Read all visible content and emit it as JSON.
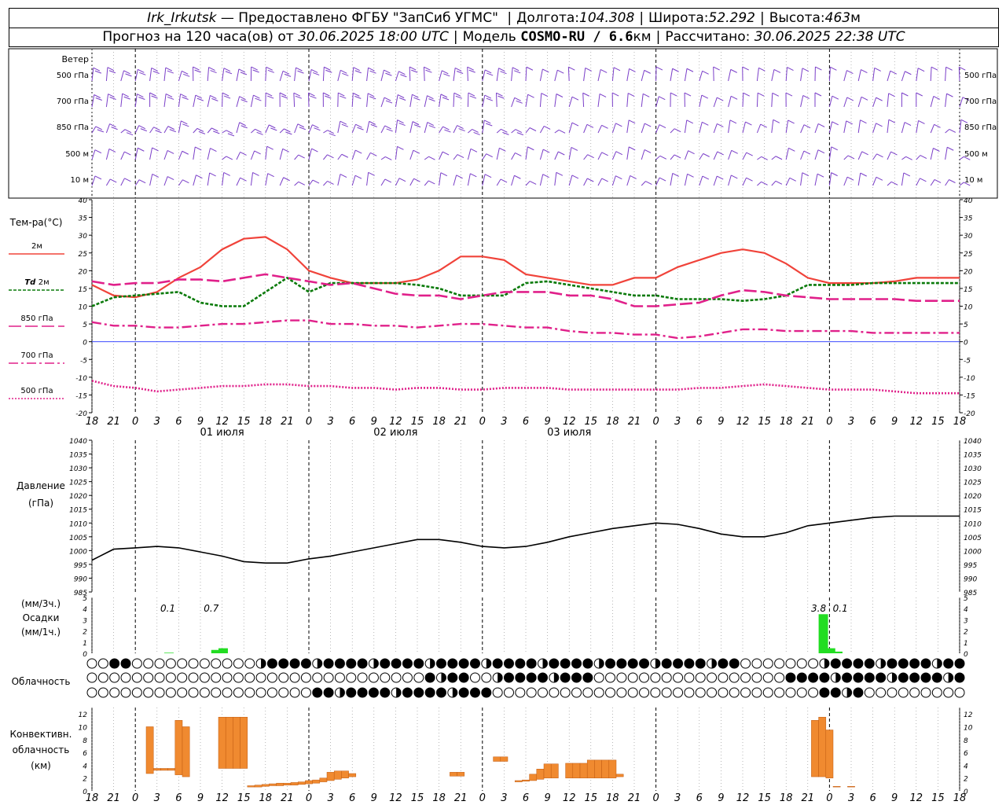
{
  "header": {
    "station": "Irk_Irkutsk",
    "provider": " — Предоставлено ФГБУ \"ЗапСиб УГМС\" ",
    "lon_label": "Долгота:",
    "lon_value": "104.308",
    "lat_label": "Широта:",
    "lat_value": "52.292",
    "alt_label": "Высота:",
    "alt_value": "463",
    "alt_unit": "м",
    "forecast_prefix": "Прогноз на 120 часа(ов) от ",
    "forecast_time": "30.06.2025 18:00 UTC",
    "model_label": "Модель ",
    "model_name": "COSMO-RU / 6.6",
    "model_unit": "км",
    "calc_label": "Рассчитано: ",
    "calc_time": "30.06.2025 22:38 UTC"
  },
  "colors": {
    "t2m": "#f0433a",
    "td2m": "#0a7a0a",
    "t850": "#e0208a",
    "t700": "#e0208a",
    "t500": "#e0208a",
    "wind": "#7a3ec8",
    "pressure": "#000000",
    "precip": "#22dd22",
    "conv": "#f08a30",
    "zero_line": "#2030ff"
  },
  "wind_panel": {
    "title": "Ветер",
    "levels": [
      "500 гПа",
      "700 гПа",
      "850 гПа",
      "500 м",
      "10  м"
    ]
  },
  "temp_panel": {
    "title": "Тем-ра(°C)",
    "legend": [
      {
        "label": "2м",
        "style": "solid"
      },
      {
        "label_italic": "Td",
        "label": "2м",
        "style": "dash-green"
      },
      {
        "label": "850 гПа",
        "style": "longdash"
      },
      {
        "label": "700 гПа",
        "style": "dashdot"
      },
      {
        "label": "500 гПа",
        "style": "dot"
      }
    ]
  },
  "time_axis": {
    "hour_labels": [
      "18",
      "21",
      "0",
      "3",
      "6",
      "9",
      "12",
      "15",
      "18",
      "21",
      "0",
      "3",
      "6",
      "9",
      "12",
      "15",
      "18",
      "21",
      "0",
      "3",
      "6",
      "9",
      "12",
      "15",
      "18",
      "21",
      "0"
    ],
    "day_labels": [
      "01 июля",
      "02 июля",
      "03 июля"
    ]
  },
  "pressure_panel": {
    "title_line1": "Давление",
    "title_line2": "(гПа)"
  },
  "precip_panel": {
    "title_line1": "(мм/3ч.)",
    "title_line2": "Осадки",
    "title_line3": "(мм/1ч.)",
    "annotations": [
      {
        "hour": 10.5,
        "text": "0.1"
      },
      {
        "hour": 16.5,
        "text": "0.7"
      },
      {
        "hour": 100.5,
        "text": "3.8"
      },
      {
        "hour": 103.5,
        "text": "0.1"
      }
    ]
  },
  "cloud_panel": {
    "title": "Облачность"
  },
  "conv_panel": {
    "title_line1": "Конвективн.",
    "title_line2": "облачность",
    "title_line3": "(км)"
  },
  "chart_data": [
    {
      "type": "line",
      "name": "temperature",
      "ylabel": "Тем-ра(°C)",
      "ylim": [
        -20,
        40
      ],
      "y_ticks": [
        -20,
        -15,
        -10,
        -5,
        0,
        5,
        10,
        15,
        20,
        25,
        30,
        35,
        40
      ],
      "xlim_hours": [
        0,
        78
      ],
      "x_hours": [
        0,
        3,
        6,
        9,
        12,
        15,
        18,
        21,
        24,
        27,
        30,
        33,
        36,
        39,
        42,
        45,
        48,
        51,
        54,
        57,
        60,
        63,
        66,
        69,
        72,
        75,
        78
      ],
      "series": [
        {
          "name": "2м",
          "values": [
            16,
            13,
            12.5,
            14,
            18,
            21,
            26,
            29,
            29.5,
            26,
            20,
            18,
            16.5,
            16.5,
            16.5,
            17.5,
            20,
            24,
            24,
            23,
            19,
            18,
            17,
            16,
            16,
            18
          ]
        },
        {
          "name": "Td 2м",
          "values": [
            10,
            12.5,
            13,
            13.5,
            14,
            11,
            10,
            10,
            14,
            18,
            14,
            16.5,
            16.5,
            16.5,
            16.5,
            16,
            15,
            13,
            13,
            13,
            16.5,
            17,
            16,
            15,
            14,
            13
          ]
        },
        {
          "name": "850 гПа",
          "values": [
            17,
            16,
            16.5,
            16.5,
            17.5,
            17.5,
            17,
            18,
            19,
            18,
            17,
            16,
            16.5,
            15,
            13.5,
            13,
            13,
            12,
            13,
            14,
            14,
            14,
            13,
            13,
            12,
            10
          ]
        },
        {
          "name": "700 гПа",
          "values": [
            5.5,
            4.5,
            4.5,
            4,
            4,
            4.5,
            5,
            5,
            5.5,
            6,
            6,
            5,
            5,
            4.5,
            4.5,
            4,
            4.5,
            5,
            5,
            4.5,
            4,
            4,
            3,
            2.5,
            2.5,
            2
          ]
        },
        {
          "name": "500 гПа",
          "values": [
            -11,
            -12.5,
            -13,
            -14,
            -13.5,
            -13,
            -12.5,
            -12.5,
            -12,
            -12,
            -12.5,
            -12.5,
            -13,
            -13,
            -13.5,
            -13,
            -13,
            -13.5,
            -13.5,
            -13,
            -13,
            -13,
            -13.5,
            -13.5,
            -13.5,
            -13.5
          ]
        }
      ],
      "continuation_hours": [
        78,
        81,
        84,
        87,
        90,
        93,
        96,
        99,
        102,
        105,
        108,
        111,
        114,
        117,
        120
      ],
      "continuation": {
        "2м": [
          18,
          21,
          23,
          25,
          26,
          25,
          22,
          18,
          16.5,
          16.5,
          16.5,
          17,
          18,
          18,
          18
        ],
        "Td 2м": [
          13,
          12,
          12,
          12,
          11.5,
          12,
          13,
          16,
          16,
          16,
          16.5,
          16.5,
          16.5,
          16.5,
          16.5
        ],
        "850 гПа": [
          10,
          10.5,
          11,
          13,
          14.5,
          14,
          13,
          12.5,
          12,
          12,
          12,
          12,
          11.5,
          11.5,
          11.5
        ],
        "700 гПа": [
          2,
          1,
          1.5,
          2.5,
          3.5,
          3.5,
          3,
          3,
          3,
          3,
          2.5,
          2.5,
          2.5,
          2.5,
          2.5
        ],
        "500 гПа": [
          -13.5,
          -13.5,
          -13,
          -13,
          -12.5,
          -12,
          -12.5,
          -13,
          -13.5,
          -13.5,
          -13.5,
          -14,
          -14.5,
          -14.5,
          -14.5
        ]
      }
    },
    {
      "type": "line",
      "name": "pressure",
      "ylabel": "Давление (гПа)",
      "ylim": [
        985,
        1040
      ],
      "y_ticks": [
        985,
        990,
        995,
        1000,
        1005,
        1010,
        1015,
        1020,
        1025,
        1030,
        1035,
        1040
      ],
      "x_hours": [
        0,
        3,
        6,
        9,
        12,
        15,
        18,
        21,
        24,
        27,
        30,
        33,
        36,
        39,
        42,
        45,
        48,
        51,
        54,
        57,
        60,
        63,
        66,
        69,
        72,
        75,
        78,
        81,
        84,
        87,
        90,
        93,
        96,
        99,
        102,
        105,
        108,
        111,
        114,
        117,
        120
      ],
      "values": [
        996.5,
        1000.5,
        1001,
        1001.5,
        1001,
        999.5,
        998,
        996,
        995.5,
        995.5,
        997,
        998,
        999.5,
        1001,
        1002.5,
        1004,
        1004,
        1003,
        1001.5,
        1001,
        1001.5,
        1003,
        1005,
        1006.5,
        1008,
        1009,
        1010,
        1009.5,
        1008,
        1006,
        1005,
        1005,
        1006.5,
        1009,
        1010,
        1011,
        1012,
        1012.5,
        1012.5,
        1012.5,
        1012.5
      ]
    },
    {
      "type": "bar",
      "name": "precipitation",
      "ylabel": "Осадки (мм/3ч.) (мм/1ч.)",
      "ylim": [
        0,
        5
      ],
      "y_ticks": [
        0,
        1,
        2,
        3,
        4,
        5
      ],
      "bars": [
        {
          "hour": 17,
          "value": 0.3
        },
        {
          "hour": 18,
          "value": 0.45
        },
        {
          "hour": 10.5,
          "value": 0.05
        },
        {
          "hour": 101,
          "value": 3.5
        },
        {
          "hour": 102,
          "value": 0.45
        },
        {
          "hour": 103,
          "value": 0.15
        }
      ]
    },
    {
      "type": "bar",
      "name": "convective_cloud",
      "ylabel": "Конвективн. облачность (км)",
      "ylim": [
        0,
        13
      ],
      "y_ticks": [
        0,
        2,
        4,
        6,
        8,
        10,
        12
      ],
      "bars": [
        {
          "hour": 8,
          "bottom": 2.7,
          "top": 10
        },
        {
          "hour": 9,
          "bottom": 3.2,
          "top": 3.5
        },
        {
          "hour": 10,
          "bottom": 3.2,
          "top": 3.5
        },
        {
          "hour": 11,
          "bottom": 3.2,
          "top": 3.5
        },
        {
          "hour": 12,
          "bottom": 2.5,
          "top": 11
        },
        {
          "hour": 13,
          "bottom": 2.2,
          "top": 10
        },
        {
          "hour": 18,
          "bottom": 3.5,
          "top": 11.5
        },
        {
          "hour": 19,
          "bottom": 3.5,
          "top": 11.5
        },
        {
          "hour": 20,
          "bottom": 3.5,
          "top": 11.5
        },
        {
          "hour": 21,
          "bottom": 3.5,
          "top": 11.5
        },
        {
          "hour": 22,
          "bottom": 0.6,
          "top": 0.8
        },
        {
          "hour": 23,
          "bottom": 0.6,
          "top": 0.9
        },
        {
          "hour": 24,
          "bottom": 0.7,
          "top": 1.0
        },
        {
          "hour": 25,
          "bottom": 0.8,
          "top": 1.1
        },
        {
          "hour": 26,
          "bottom": 0.8,
          "top": 1.2
        },
        {
          "hour": 27,
          "bottom": 0.9,
          "top": 1.2
        },
        {
          "hour": 28,
          "bottom": 0.9,
          "top": 1.3
        },
        {
          "hour": 29,
          "bottom": 1.0,
          "top": 1.4
        },
        {
          "hour": 30,
          "bottom": 1.1,
          "top": 1.6
        },
        {
          "hour": 31,
          "bottom": 1.2,
          "top": 1.7
        },
        {
          "hour": 32,
          "bottom": 1.4,
          "top": 2.0
        },
        {
          "hour": 33,
          "bottom": 1.6,
          "top": 2.9
        },
        {
          "hour": 34,
          "bottom": 1.8,
          "top": 3.1
        },
        {
          "hour": 35,
          "bottom": 2.0,
          "top": 3.1
        },
        {
          "hour": 36,
          "bottom": 2.2,
          "top": 2.7
        },
        {
          "hour": 50,
          "bottom": 2.3,
          "top": 2.9
        },
        {
          "hour": 51,
          "bottom": 2.3,
          "top": 2.9
        },
        {
          "hour": 56,
          "bottom": 4.6,
          "top": 5.3
        },
        {
          "hour": 57,
          "bottom": 4.6,
          "top": 5.3
        },
        {
          "hour": 59,
          "bottom": 1.4,
          "top": 1.6
        },
        {
          "hour": 60,
          "bottom": 1.5,
          "top": 1.7
        },
        {
          "hour": 61,
          "bottom": 1.6,
          "top": 2.6
        },
        {
          "hour": 62,
          "bottom": 1.8,
          "top": 3.4
        },
        {
          "hour": 63,
          "bottom": 2.0,
          "top": 4.2
        },
        {
          "hour": 64,
          "bottom": 2.0,
          "top": 4.2
        },
        {
          "hour": 66,
          "bottom": 2.0,
          "top": 4.3
        },
        {
          "hour": 67,
          "bottom": 2.0,
          "top": 4.3
        },
        {
          "hour": 68,
          "bottom": 2.0,
          "top": 4.3
        },
        {
          "hour": 69,
          "bottom": 2.0,
          "top": 4.8
        },
        {
          "hour": 70,
          "bottom": 2.0,
          "top": 4.8
        },
        {
          "hour": 71,
          "bottom": 2.0,
          "top": 4.8
        },
        {
          "hour": 72,
          "bottom": 2.0,
          "top": 4.8
        },
        {
          "hour": 73,
          "bottom": 2.2,
          "top": 2.6
        },
        {
          "hour": 100,
          "bottom": 2.2,
          "top": 11
        },
        {
          "hour": 101,
          "bottom": 2.2,
          "top": 11.5
        },
        {
          "hour": 102,
          "bottom": 2.0,
          "top": 9.5
        },
        {
          "hour": 103,
          "bottom": 0.6,
          "top": 0.7
        },
        {
          "hour": 105,
          "bottom": 0.6,
          "top": 0.7
        }
      ]
    }
  ]
}
